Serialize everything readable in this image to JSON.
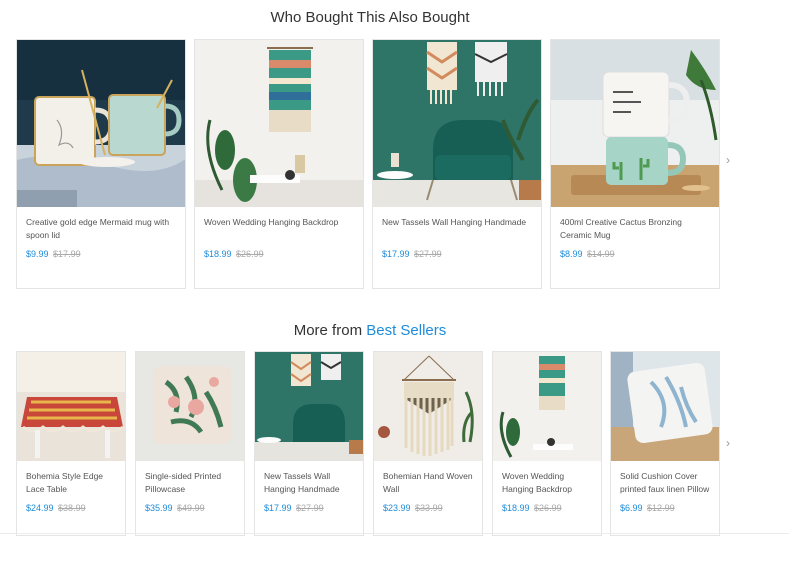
{
  "section1": {
    "title": "Who Bought This Also Bought",
    "products": [
      {
        "name": "Creative gold edge Mermaid mug with spoon lid",
        "price": "$9.99",
        "old_price": "$17.99"
      },
      {
        "name": "Woven Wedding Hanging Backdrop",
        "price": "$18.99",
        "old_price": "$26.99"
      },
      {
        "name": "New Tassels Wall Hanging Handmade",
        "price": "$17.99",
        "old_price": "$27.99"
      },
      {
        "name": "400ml Creative Cactus Bronzing Ceramic Mug",
        "price": "$8.99",
        "old_price": "$14.99"
      }
    ],
    "next_arrow": "›"
  },
  "section2": {
    "title_prefix": "More from",
    "title_link": "Best Sellers",
    "products": [
      {
        "name": "Bohemia Style Edge Lace Table",
        "price": "$24.99",
        "old_price": "$38.99"
      },
      {
        "name": "Single-sided Printed Pillowcase",
        "price": "$35.99",
        "old_price": "$49.99"
      },
      {
        "name": "New Tassels Wall Hanging Handmade",
        "price": "$17.99",
        "old_price": "$27.99"
      },
      {
        "name": "Bohemian Hand Woven Wall",
        "price": "$23.99",
        "old_price": "$33.99"
      },
      {
        "name": "Woven Wedding Hanging Backdrop",
        "price": "$18.99",
        "old_price": "$26.99"
      },
      {
        "name": "Solid Cushion Cover printed faux linen Pillow",
        "price": "$6.99",
        "old_price": "$12.99"
      }
    ],
    "next_arrow": "›"
  },
  "colors": {
    "accent": "#1e8cd9",
    "old_price": "#aaaaaa",
    "border": "#e4e4e4"
  }
}
